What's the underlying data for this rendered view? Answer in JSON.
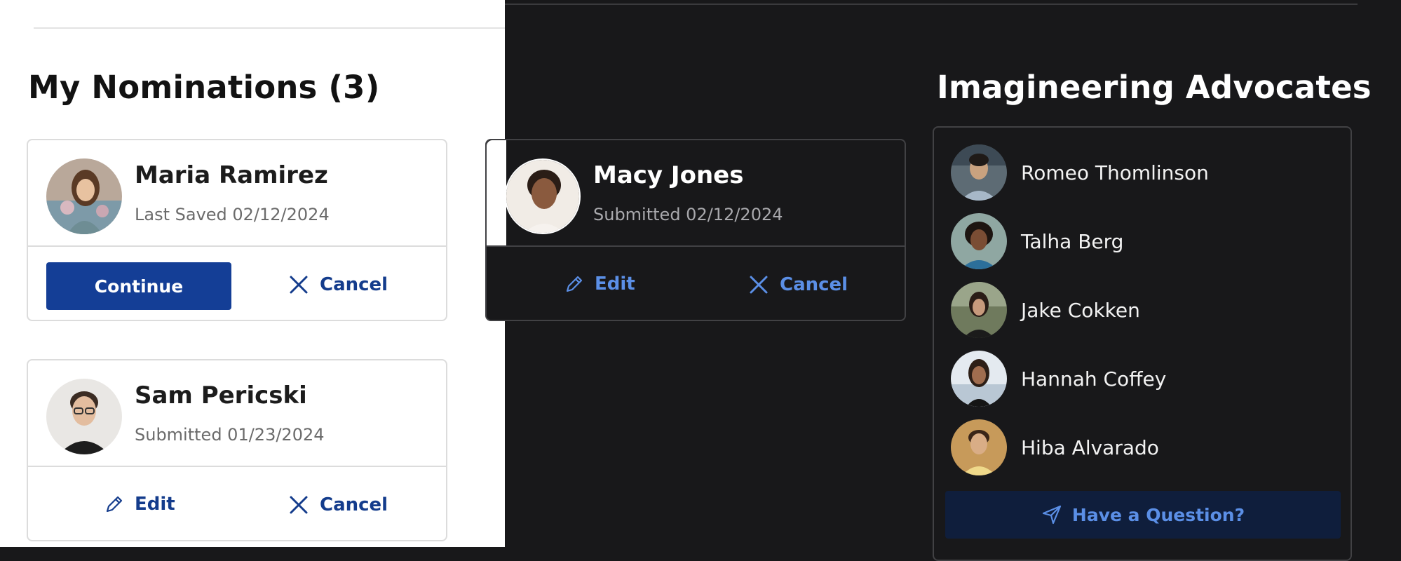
{
  "nominations": {
    "heading": "My Nominations (3)",
    "cards": [
      {
        "name": "Maria Ramirez",
        "status": "Last Saved 02/12/2024",
        "primary_action": "Continue",
        "cancel_action": "Cancel"
      },
      {
        "name": "Macy Jones",
        "status": "Submitted 02/12/2024",
        "edit_action": "Edit",
        "cancel_action": "Cancel"
      },
      {
        "name": "Sam Pericski",
        "status": "Submitted 01/23/2024",
        "edit_action": "Edit",
        "cancel_action": "Cancel"
      }
    ]
  },
  "advocates": {
    "heading": "Imagineering Advocates",
    "people": [
      {
        "name": "Romeo Thomlinson"
      },
      {
        "name": "Talha Berg"
      },
      {
        "name": "Jake Cokken"
      },
      {
        "name": "Hannah Coffey"
      },
      {
        "name": "Hiba Alvarado"
      }
    ],
    "question_label": "Have a Question?"
  },
  "colors": {
    "primary": "#143e96",
    "link_light": "#143c8c",
    "link_dark": "#5b8fe6",
    "dark_bg": "#18181a",
    "light_bg": "#ffffff"
  }
}
